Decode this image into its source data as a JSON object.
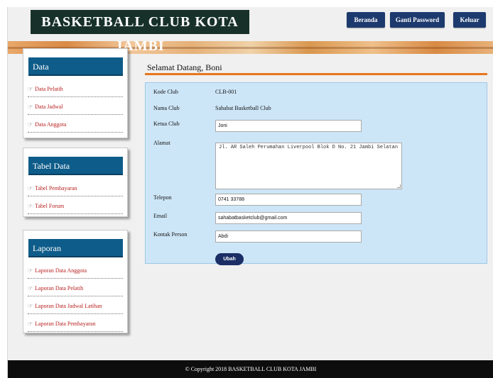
{
  "header": {
    "site_title": "BASKETBALL CLUB KOTA JAMBI",
    "nav": {
      "home": "Beranda",
      "change_password": "Ganti Password",
      "logout": "Keluar"
    }
  },
  "sidebar": {
    "data": {
      "title": "Data",
      "items": [
        "Data Pelatih",
        "Data Jadwal",
        "Data Anggota"
      ]
    },
    "tabel": {
      "title": "Tabel Data",
      "items": [
        "Tabel Pembayaran",
        "Tabel Forum"
      ]
    },
    "laporan": {
      "title": "Laporan",
      "items": [
        "Laporan Data Anggota",
        "Laporan Data Pelatih",
        "Laporan Data Jadwal Latihan",
        "Laporan Data Pembayaran"
      ]
    }
  },
  "main": {
    "welcome": "Selamat Datang, Boni",
    "form": {
      "kode_label": "Kode Club",
      "kode_value": "CLB-001",
      "nama_label": "Nama Club",
      "nama_value": "Sahabat Basketball Club",
      "ketua_label": "Ketua Club",
      "ketua_value": "Joni",
      "alamat_label": "Alamat",
      "alamat_value": "Jl. AR Saleh Perumahan Liverpool Blok D No. 21 Jambi Selatan",
      "telepon_label": "Telepon",
      "telepon_value": "0741 33788",
      "email_label": "Email",
      "email_value": "sahabatbasketclub@gmail.com",
      "kontak_label": "Kontak Person",
      "kontak_value": "Abdi",
      "submit_label": "Ubah"
    }
  },
  "footer": {
    "copyright": "© Copyright 2018 BASKETBALL CLUB KOTA JAMBI"
  }
}
